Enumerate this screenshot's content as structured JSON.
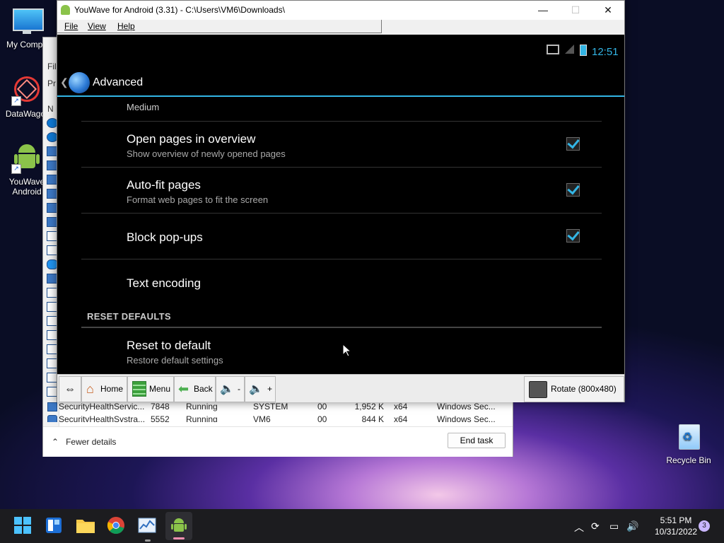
{
  "desktop": {
    "icons": [
      {
        "label": "My Compu"
      },
      {
        "label": "DataWagor"
      },
      {
        "label": "YouWave\nAndroid"
      },
      {
        "label": "Recycle Bin"
      }
    ]
  },
  "taskmgr": {
    "side_letters": [
      "Fil",
      "Pr",
      "N"
    ],
    "rows": [
      {
        "name": "SecurityHealthServic...",
        "pid": "7848",
        "status": "Running",
        "user": "SYSTEM",
        "cpu": "00",
        "mem": "1,952 K",
        "arch": "x64",
        "desc": "Windows Sec..."
      },
      {
        "name": "SecurityHealthSystra...",
        "pid": "5552",
        "status": "Running",
        "user": "VM6",
        "cpu": "00",
        "mem": "844 K",
        "arch": "x64",
        "desc": "Windows Sec..."
      }
    ],
    "fewer_details": "Fewer details",
    "end_task": "End task"
  },
  "youwave": {
    "title": "YouWave for Android (3.31) - C:\\Users\\VM6\\Downloads\\",
    "menu": [
      "File",
      "View",
      "Help"
    ],
    "android": {
      "clock": "12:51",
      "actionbar_title": "Advanced",
      "partial_value": "Medium",
      "prefs": [
        {
          "title": "Open pages in overview",
          "summary": "Show overview of newly opened pages",
          "checked": true
        },
        {
          "title": "Auto-fit pages",
          "summary": "Format web pages to fit the screen",
          "checked": true
        },
        {
          "title": "Block pop-ups",
          "summary": "",
          "checked": true
        },
        {
          "title": "Text encoding",
          "summary": ""
        }
      ],
      "category": "RESET DEFAULTS",
      "reset": {
        "title": "Reset to default",
        "summary": "Restore default settings"
      }
    },
    "toolbar": {
      "home": "Home",
      "menu": "Menu",
      "back": "Back",
      "vol_minus": "-",
      "vol_plus": "+",
      "rotate": "Rotate (800x480)"
    }
  },
  "taskbar": {
    "time": "5:51 PM",
    "date": "10/31/2022",
    "notifications": "3"
  },
  "colors": {
    "accent": "#33b5e5"
  }
}
